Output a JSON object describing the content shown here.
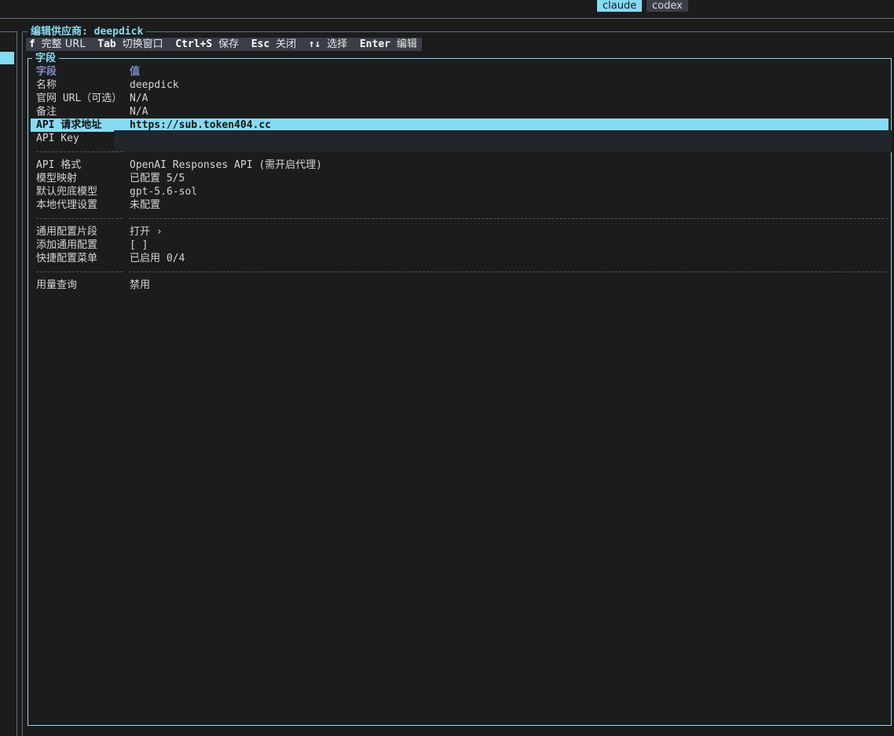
{
  "tabs": [
    {
      "label": "claude",
      "active": true
    },
    {
      "label": "codex",
      "active": false
    }
  ],
  "editor": {
    "title": "编辑供应商: deepdick"
  },
  "shortcuts": [
    {
      "key": "f",
      "desc": "完整 URL"
    },
    {
      "key": "Tab",
      "desc": "切换窗口"
    },
    {
      "key": "Ctrl+S",
      "desc": "保存"
    },
    {
      "key": "Esc",
      "desc": "关闭"
    },
    {
      "key": "↑↓",
      "desc": "选择"
    },
    {
      "key": "Enter",
      "desc": "编辑"
    }
  ],
  "panel": {
    "title": "字段",
    "header_field": "字段",
    "header_value": "值"
  },
  "fields": [
    {
      "label": "名称",
      "value": "deepdick"
    },
    {
      "label": "官网 URL（可选）",
      "value": "N/A"
    },
    {
      "label": "备注",
      "value": "N/A"
    },
    {
      "label": "API 请求地址",
      "value": "https://sub.token404.cc",
      "selected": true
    },
    {
      "label": "API Key",
      "value": ""
    },
    {
      "label": "API 格式",
      "value": "OpenAI Responses API (需开启代理)"
    },
    {
      "label": "模型映射",
      "value": "已配置 5/5"
    },
    {
      "label": "默认兜底模型",
      "value": "gpt-5.6-sol"
    },
    {
      "label": "本地代理设置",
      "value": "未配置"
    },
    {
      "label": "通用配置片段",
      "value": "打开 ›"
    },
    {
      "label": "添加通用配置",
      "value": "[ ]"
    },
    {
      "label": "快捷配置菜单",
      "value": "已启用 0/4"
    },
    {
      "label": "用量查询",
      "value": "禁用"
    }
  ],
  "colors": {
    "accent": "#84dcf2",
    "header": "#7a8ec8",
    "background": "#1c1c1c",
    "shortcut_bar": "#3a3f47"
  }
}
